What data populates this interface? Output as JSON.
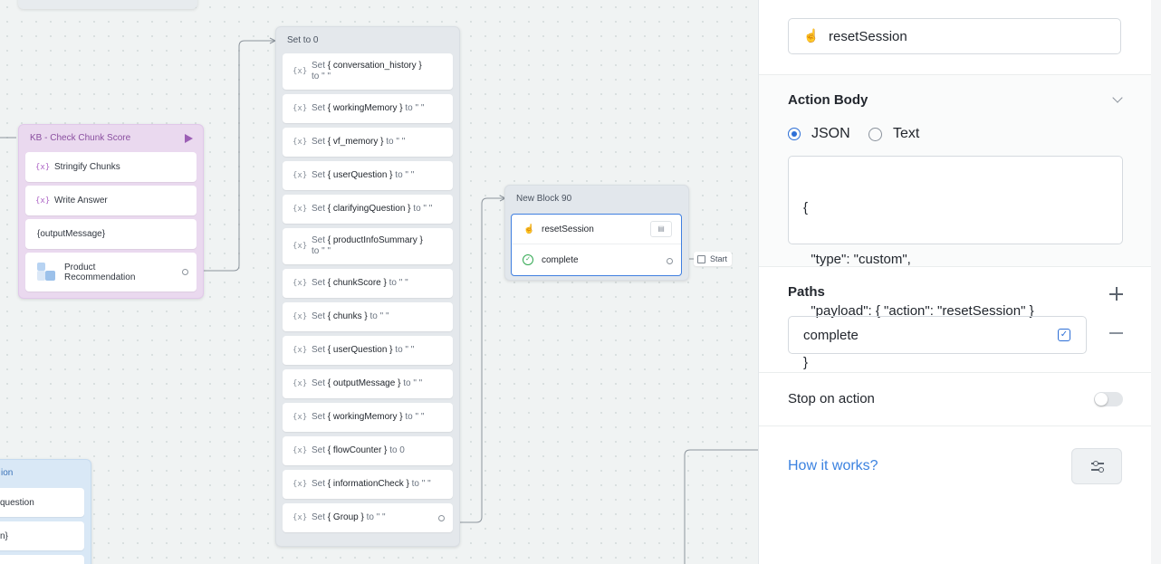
{
  "canvas": {
    "kb_block": {
      "title": "KB - Check Chunk Score",
      "steps": [
        {
          "icon": "{x}",
          "label": "Stringify Chunks"
        },
        {
          "icon": "{x}",
          "label": "Write Answer"
        },
        {
          "icon": "",
          "label": "{outputMessage}"
        },
        {
          "icon": "",
          "label": "Product Recommendation"
        }
      ]
    },
    "set_block": {
      "title": "Set to 0",
      "steps": [
        {
          "pre": "Set",
          "var": "{ conversation_history }",
          "post": "to \" \""
        },
        {
          "pre": "Set",
          "var": "{ workingMemory }",
          "post": "to \" \""
        },
        {
          "pre": "Set",
          "var": "{ vf_memory }",
          "post": "to \" \""
        },
        {
          "pre": "Set",
          "var": "{ userQuestion }",
          "post": "to \" \""
        },
        {
          "pre": "Set",
          "var": "{ clarifyingQuestion }",
          "post": "to \" \""
        },
        {
          "pre": "Set",
          "var": "{ productInfoSummary }",
          "post": "to \" \""
        },
        {
          "pre": "Set",
          "var": "{ chunkScore }",
          "post": "to \" \""
        },
        {
          "pre": "Set",
          "var": "{ chunks }",
          "post": "to \" \""
        },
        {
          "pre": "Set",
          "var": "{ userQuestion }",
          "post": "to \" \""
        },
        {
          "pre": "Set",
          "var": "{ outputMessage }",
          "post": "to \" \""
        },
        {
          "pre": "Set",
          "var": "{ workingMemory }",
          "post": "to \" \""
        },
        {
          "pre": "Set",
          "var": "{ flowCounter }",
          "post": "to 0"
        },
        {
          "pre": "Set",
          "var": "{ informationCheck }",
          "post": "to \" \""
        },
        {
          "pre": "Set",
          "var": "{ Group }",
          "post": "to \" \""
        }
      ]
    },
    "new_block": {
      "title": "New Block 90",
      "action_label": "resetSession",
      "path_label": "complete",
      "start_label": "Start"
    },
    "partial_block": {
      "title": "ion",
      "items": [
        "question",
        "n}"
      ]
    }
  },
  "panel": {
    "action_name": "resetSession",
    "action_body_title": "Action Body",
    "radio_json": "JSON",
    "radio_text": "Text",
    "body_lines": [
      "{",
      "  \"type\": \"custom\",",
      "  \"payload\": { \"action\": \"resetSession\" }",
      "}"
    ],
    "paths_title": "Paths",
    "path_value": "complete",
    "stop_label": "Stop on action",
    "how_it_works": "How it works?",
    "colors": {
      "accent": "#2d6fd6",
      "link": "#3b82e0",
      "kb_block": "#e9d6ef",
      "new_block": "#dfe6ec"
    }
  }
}
